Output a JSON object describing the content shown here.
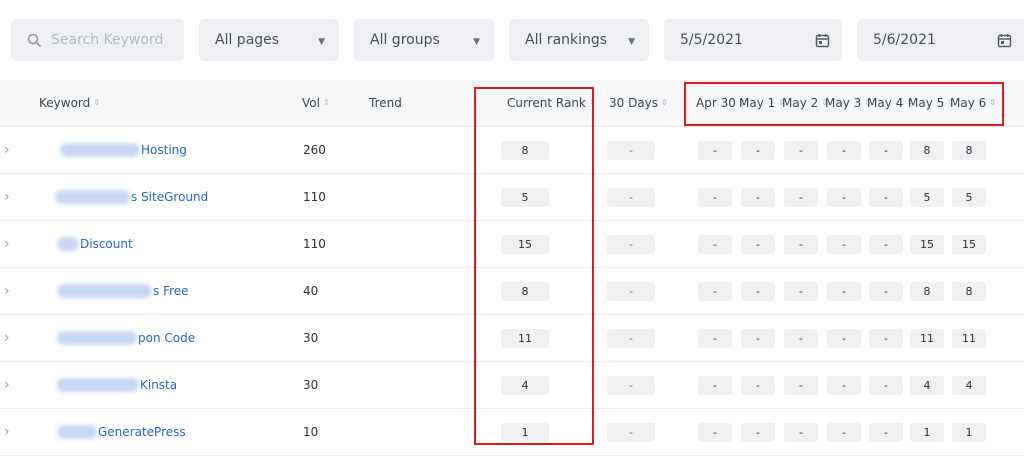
{
  "filters": {
    "search_placeholder": "Search Keyword",
    "pages": "All pages",
    "groups": "All groups",
    "rankings": "All rankings",
    "date_start": "5/5/2021",
    "date_end": "5/6/2021"
  },
  "columns": {
    "keyword": "Keyword",
    "vol": "Vol",
    "trend": "Trend",
    "current_rank": "Current Rank",
    "days30": "30 Days",
    "days": [
      "Apr 30",
      "May 1",
      "May 2",
      "May 3",
      "May 4",
      "May 5",
      "May 6"
    ]
  },
  "rows": [
    {
      "keyword": "Hosting",
      "vol": "260",
      "current_rank": "8",
      "days30": "-",
      "days": [
        "-",
        "-",
        "-",
        "-",
        "-",
        "8",
        "8"
      ]
    },
    {
      "keyword": "s SiteGround",
      "vol": "110",
      "current_rank": "5",
      "days30": "-",
      "days": [
        "-",
        "-",
        "-",
        "-",
        "-",
        "5",
        "5"
      ]
    },
    {
      "keyword": "Discount",
      "vol": "110",
      "current_rank": "15",
      "days30": "-",
      "days": [
        "-",
        "-",
        "-",
        "-",
        "-",
        "15",
        "15"
      ]
    },
    {
      "keyword": "s Free",
      "vol": "40",
      "current_rank": "8",
      "days30": "-",
      "days": [
        "-",
        "-",
        "-",
        "-",
        "-",
        "8",
        "8"
      ]
    },
    {
      "keyword": "pon Code",
      "vol": "30",
      "current_rank": "11",
      "days30": "-",
      "days": [
        "-",
        "-",
        "-",
        "-",
        "-",
        "11",
        "11"
      ]
    },
    {
      "keyword": "Kinsta",
      "vol": "30",
      "current_rank": "4",
      "days30": "-",
      "days": [
        "-",
        "-",
        "-",
        "-",
        "-",
        "4",
        "4"
      ]
    },
    {
      "keyword": "GeneratePress",
      "vol": "10",
      "current_rank": "1",
      "days30": "-",
      "days": [
        "-",
        "-",
        "-",
        "-",
        "-",
        "1",
        "1"
      ]
    }
  ],
  "colors": {
    "highlight": "#e01b1b",
    "link": "#2766c9",
    "pill": "#f0f1f3"
  }
}
